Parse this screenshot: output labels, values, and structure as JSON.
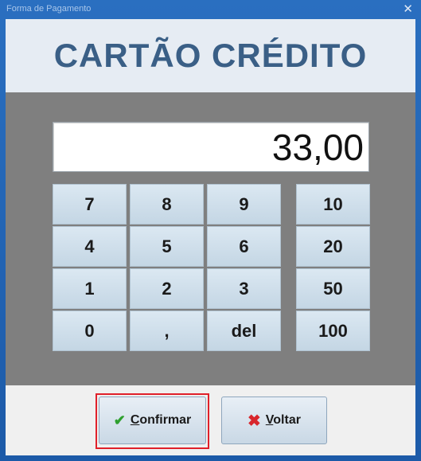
{
  "window": {
    "title": "Forma de Pagamento",
    "close_glyph": "✕"
  },
  "header": {
    "title": "CARTÃO CRÉDITO"
  },
  "display": {
    "value": "33,00"
  },
  "keypad": {
    "digits": [
      "7",
      "8",
      "9",
      "4",
      "5",
      "6",
      "1",
      "2",
      "3",
      "0",
      ",",
      "del"
    ],
    "quick_amounts": [
      "10",
      "20",
      "50",
      "100"
    ]
  },
  "footer": {
    "confirm_label": "Confirmar",
    "back_label": "Voltar",
    "confirm_icon": "check-icon",
    "back_icon": "x-icon"
  },
  "colors": {
    "title_text": "#3a5f86",
    "panel_bg": "#7f7f7f",
    "focus_ring": "#e0202a",
    "window_frame": "#1c5aa8"
  }
}
